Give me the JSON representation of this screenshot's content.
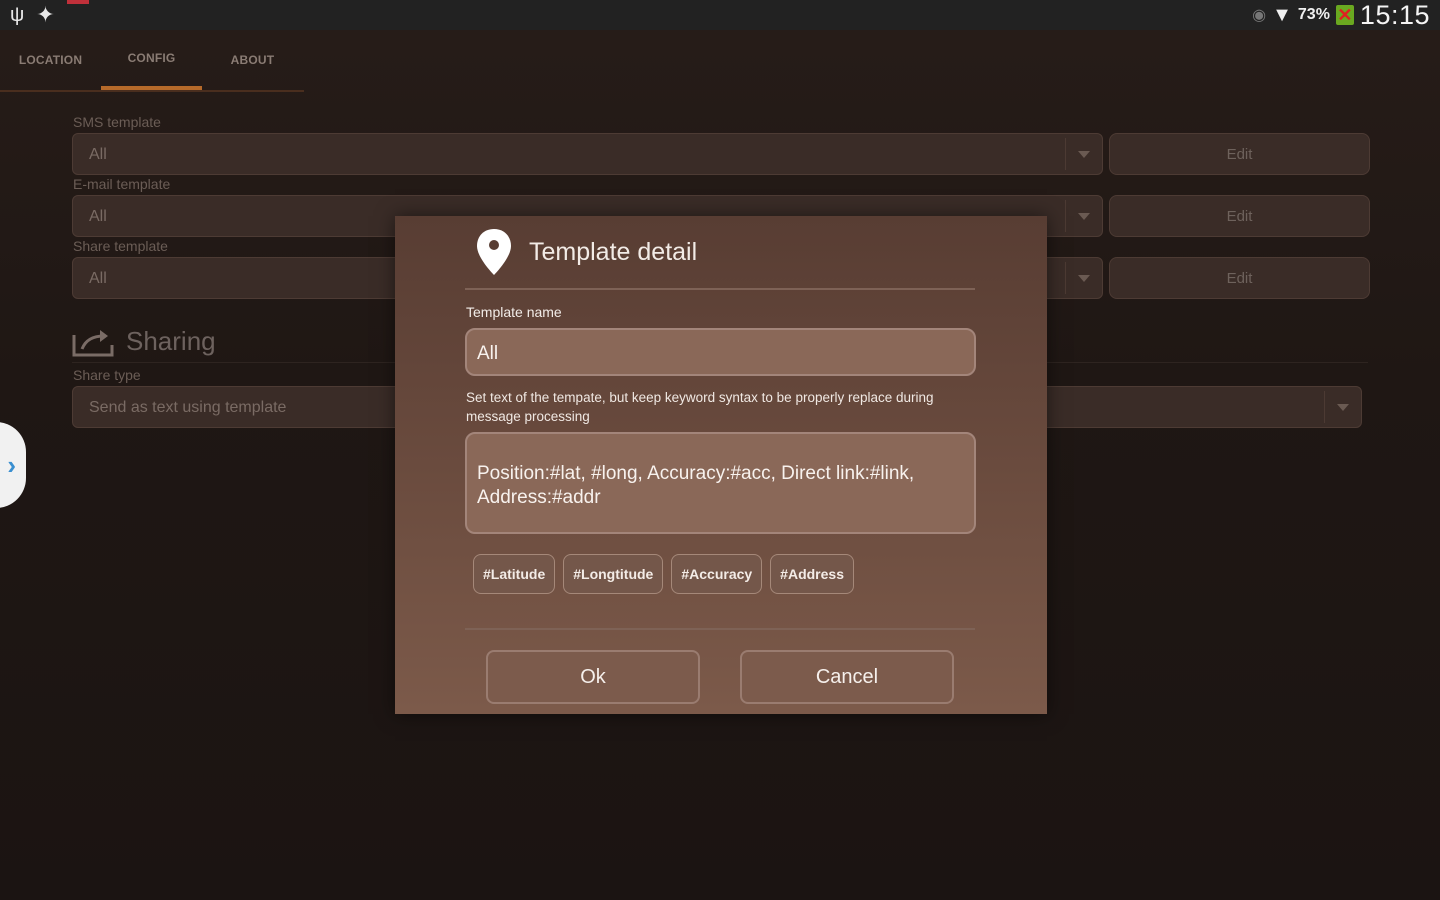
{
  "status_bar": {
    "battery_percent": "73%",
    "time": "15:15",
    "icons": [
      "usb-icon",
      "gps-icon",
      "eye-icon",
      "wifi-icon",
      "battery-icon"
    ]
  },
  "tabs": [
    {
      "label": "LOCATION"
    },
    {
      "label": "CONFIG"
    },
    {
      "label": "ABOUT"
    }
  ],
  "config": {
    "sms_label": "SMS template",
    "sms_value": "All",
    "email_label": "E-mail template",
    "email_value": "All",
    "share_label": "Share template",
    "share_value": "All",
    "edit_label": "Edit",
    "sharing_title": "Sharing",
    "share_type_label": "Share type",
    "share_type_value": "Send as text using template"
  },
  "dialog": {
    "title": "Template detail",
    "name_label": "Template name",
    "name_value": "All",
    "help_text": "Set text of the tempate, but keep keyword syntax to be properly replace during message processing",
    "body_value": "Position:#lat, #long, Accuracy:#acc, Direct link:#link, Address:#addr",
    "chips": [
      "#Latitude",
      "#Longtitude",
      "#Accuracy",
      "#Address"
    ],
    "ok_label": "Ok",
    "cancel_label": "Cancel"
  },
  "colors": {
    "accent": "#b66a2a",
    "dialog_bg": "#6a4b3e",
    "handle_arrow": "#3a8fd0"
  }
}
